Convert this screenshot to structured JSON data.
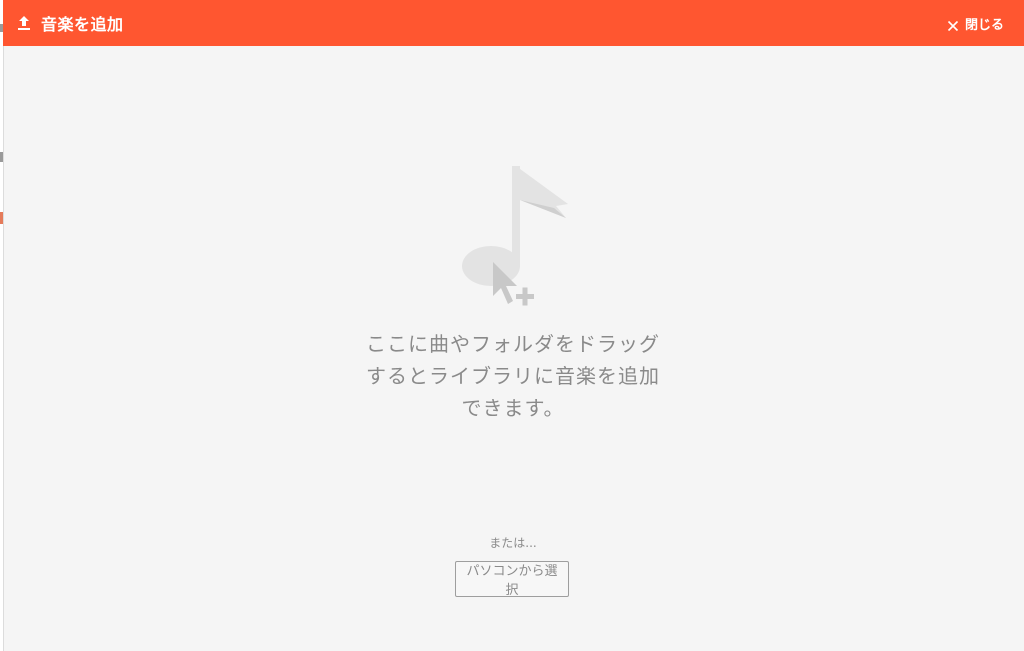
{
  "header": {
    "title": "音楽を追加",
    "close_label": "閉じる",
    "upload_icon": "upload-icon",
    "close_icon": "close-icon",
    "accent_color": "#ff5630"
  },
  "main": {
    "illustration_icon": "music-note-with-add-cursor-icon",
    "drop_message": {
      "line1": "ここに曲やフォルダをドラッグ",
      "line2": "するとライブラリに音楽を追加",
      "line3": "できます。"
    },
    "or_text": "または...",
    "select_button_label": "パソコンから選択"
  }
}
